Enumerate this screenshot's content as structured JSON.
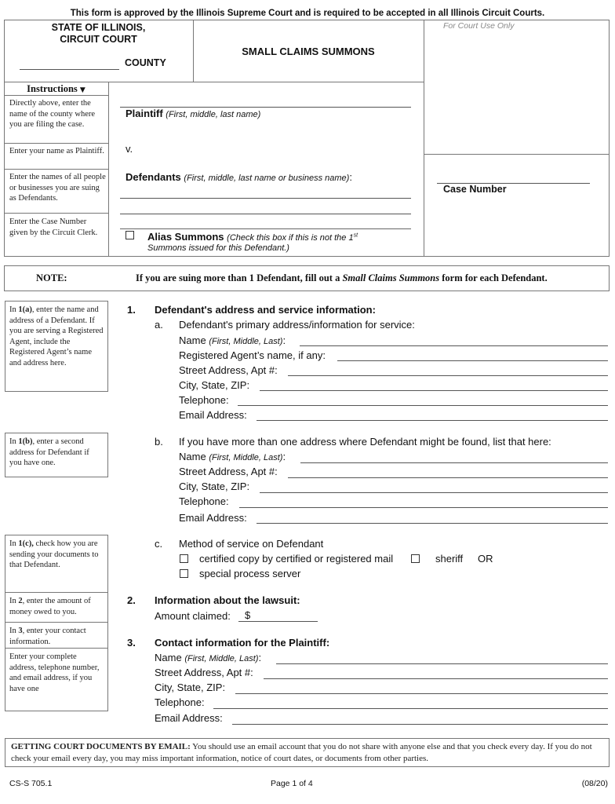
{
  "header_notice": "This form is approved by the Illinois Supreme Court and is required to be accepted in all Illinois Circuit Courts.",
  "court": {
    "line1": "STATE OF ILLINOIS,",
    "line2": "CIRCUIT COURT",
    "county_label": "COUNTY",
    "county_value": ""
  },
  "form_title": "SMALL CLAIMS SUMMONS",
  "court_use_label": "For Court Use Only",
  "instructions": {
    "header": "Instructions",
    "toggle_icon": "caret-down-icon",
    "county": "Directly above, enter the name of the county where you are filing the case.",
    "plaintiff": "Enter your name as Plaintiff.",
    "defendants": "Enter the names of all people or businesses you are suing as Defendants.",
    "case_number": "Enter the Case Number given by the Circuit Clerk."
  },
  "caption": {
    "plaintiff_label": "Plaintiff",
    "plaintiff_hint": "(First, middle, last name)",
    "plaintiff_value": "",
    "versus": "v.",
    "defendants_label": "Defendants",
    "defendants_hint": "(First, middle, last name or business name)",
    "defendants_colon": ":",
    "defendant_line1": "",
    "defendant_line2": "",
    "alias_label": "Alias Summons",
    "alias_hint_pre": "(Check this box if this is not the 1",
    "alias_hint_sup": "st",
    "alias_hint_post": "Summons issued for this Defendant.)",
    "alias_checked": false,
    "case_number_label": "Case Number",
    "case_number_value": ""
  },
  "note": {
    "label": "NOTE:",
    "text_pre": "If you are suing more than 1 Defendant, fill out a ",
    "text_italic": "Small Claims Summons",
    "text_post": " form for each Defendant."
  },
  "side_notes": {
    "s1a_pre": "In ",
    "s1a_bold": "1(a)",
    "s1a_post": ", enter the name and address of a Defendant. If you are serving a Registered Agent, include the Registered Agent’s name and address here.",
    "s1b_pre": "In ",
    "s1b_bold": "1(b)",
    "s1b_post": ", enter a second address for Defendant if you have one.",
    "s1c_pre": "In ",
    "s1c_bold": "1(c),",
    "s1c_post": " check how you are sending your documents to that Defendant.",
    "s2_pre": "In ",
    "s2_bold": "2",
    "s2_post": ", enter the amount of money owed to you.",
    "s3_pre": "In ",
    "s3_bold": "3",
    "s3_post": ", enter your contact information.",
    "s3_detail": "Enter your complete address, telephone number, and email address, if you have one"
  },
  "section1": {
    "num": "1.",
    "title": "Defendant's address and service information:",
    "a": {
      "letter": "a.",
      "title": "Defendant's primary address/information for service:",
      "name_label": "Name",
      "name_hint": "(First, Middle, Last)",
      "colon": ":",
      "agent_label": "Registered Agent’s name, if any:",
      "street_label": "Street Address, Apt #:",
      "city_label": "City, State, ZIP:",
      "phone_label": "Telephone:",
      "email_label": "Email Address:",
      "name_value": "",
      "agent_value": "",
      "street_value": "",
      "city_value": "",
      "phone_value": "",
      "email_value": ""
    },
    "b": {
      "letter": "b.",
      "title": "If you have more than one address where Defendant might be found, list that here:",
      "name_label": "Name",
      "name_hint": "(First, Middle, Last)",
      "colon": ":",
      "street_label": "Street Address, Apt #:",
      "city_label": "City, State, ZIP:",
      "phone_label": "Telephone:",
      "email_label": "Email Address:",
      "name_value": "",
      "street_value": "",
      "city_value": "",
      "phone_value": "",
      "email_value": ""
    },
    "c": {
      "letter": "c.",
      "title": "Method of service on Defendant",
      "opt_mail": "certified copy by certified or registered mail",
      "opt_sheriff": "sheriff",
      "or_text": "OR",
      "opt_process": "special process server",
      "mail_checked": false,
      "sheriff_checked": false,
      "process_checked": false
    }
  },
  "section2": {
    "num": "2.",
    "title": "Information about the lawsuit:",
    "amount_label": "Amount claimed:",
    "currency": "$",
    "amount_value": ""
  },
  "section3": {
    "num": "3.",
    "title": "Contact information for the Plaintiff:",
    "name_label": "Name",
    "name_hint": "(First, Middle, Last)",
    "colon": ":",
    "street_label": "Street Address, Apt #:",
    "city_label": "City, State, ZIP:",
    "phone_label": "Telephone:",
    "email_label": "Email Address:",
    "name_value": "",
    "street_value": "",
    "city_value": "",
    "phone_value": "",
    "email_value": ""
  },
  "email_notice": {
    "bold": "GETTING COURT DOCUMENTS BY EMAIL:",
    "text": " You should use an email account that you do not share with anyone else and that you check every day. If you do not check your email every day, you may miss important information, notice of court dates, or documents from other parties."
  },
  "footer": {
    "form_code": "CS-S 705.1",
    "page": "Page 1 of 4",
    "revision": "(08/20)"
  }
}
